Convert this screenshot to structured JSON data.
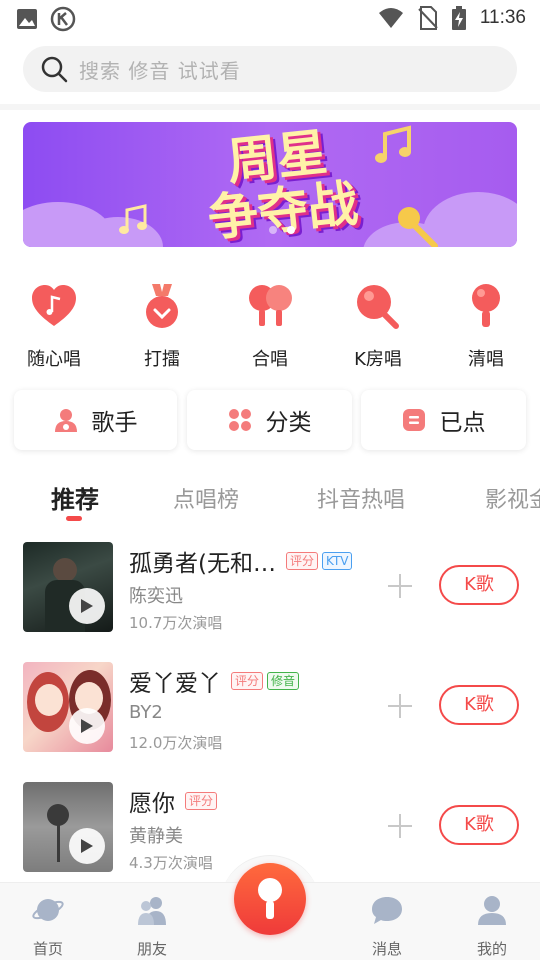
{
  "status_bar": {
    "time": "11:36",
    "left_icons": [
      "image-icon",
      "k-circle-icon"
    ],
    "right_icons": [
      "wifi-icon",
      "no-sim-icon",
      "battery-charging-icon"
    ]
  },
  "search": {
    "placeholder": "搜索 修音 试试看",
    "icon": "search-icon"
  },
  "banner": {
    "title_line1": "周星",
    "title_line2": "争夺战",
    "dots_count": 2,
    "active_dot": 1
  },
  "quick_menu": [
    {
      "label": "随心唱",
      "icon": "heart-music-icon"
    },
    {
      "label": "打擂",
      "icon": "medal-icon"
    },
    {
      "label": "合唱",
      "icon": "duet-mic-icon"
    },
    {
      "label": "K房唱",
      "icon": "k-room-mic-icon"
    },
    {
      "label": "清唱",
      "icon": "mic-icon"
    }
  ],
  "cards": [
    {
      "label": "歌手",
      "icon": "singer-icon"
    },
    {
      "label": "分类",
      "icon": "category-icon"
    },
    {
      "label": "已点",
      "icon": "selected-list-icon"
    }
  ],
  "tabs": [
    {
      "label": "推荐",
      "active": true
    },
    {
      "label": "点唱榜",
      "active": false
    },
    {
      "label": "抖音热唱",
      "active": false
    },
    {
      "label": "影视金",
      "active": false
    }
  ],
  "songs": [
    {
      "title": "孤勇者(无和…",
      "artist": "陈奕迅",
      "plays": "10.7万次演唱",
      "tags": [
        "评分",
        "KTV"
      ],
      "button": "K歌"
    },
    {
      "title": "爱丫爱丫",
      "artist": "BY2",
      "plays": "12.0万次演唱",
      "tags": [
        "评分",
        "修音"
      ],
      "button": "K歌"
    },
    {
      "title": "愿你",
      "artist": "黄静美",
      "plays": "4.3万次演唱",
      "tags": [
        "评分"
      ],
      "button": "K歌"
    }
  ],
  "bottom_nav": [
    {
      "label": "首页",
      "icon": "planet-icon"
    },
    {
      "label": "朋友",
      "icon": "friends-icon"
    },
    {
      "label": "",
      "icon": "mic-icon"
    },
    {
      "label": "消息",
      "icon": "message-icon"
    },
    {
      "label": "我的",
      "icon": "profile-icon"
    }
  ],
  "colors": {
    "accent": "#f44a4a",
    "banner": "#9b59f0",
    "tag_rating": "#f47b7b",
    "tag_ktv": "#4a9ff0",
    "tag_tune": "#43b34a"
  }
}
